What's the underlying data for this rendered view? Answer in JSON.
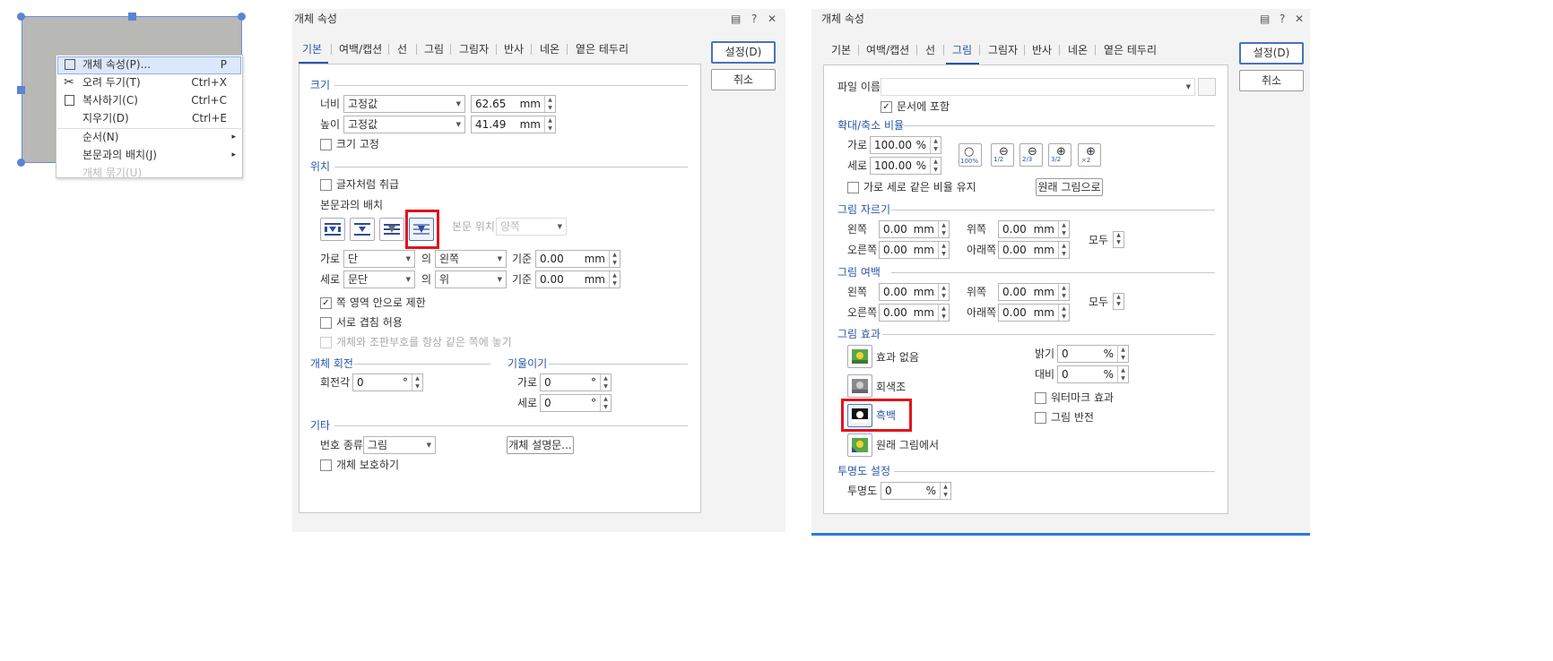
{
  "context": {
    "menu": [
      {
        "label": "개체 속성(P)...",
        "key": "P"
      },
      {
        "label": "오려 두기(T)",
        "key": "Ctrl+X"
      },
      {
        "label": "복사하기(C)",
        "key": "Ctrl+C"
      },
      {
        "label": "지우기(D)",
        "key": "Ctrl+E"
      },
      {
        "label": "순서(N)",
        "key": "▸"
      },
      {
        "label": "본문과의 배치(J)",
        "key": "▸"
      },
      {
        "label": "개체 묶기(U)",
        "key": ""
      }
    ]
  },
  "dlg1": {
    "title": "개체 속성",
    "tabs": [
      "기본",
      "여백/캡션",
      "선",
      "그림",
      "그림자",
      "반사",
      "네온",
      "옅은 테두리"
    ],
    "ok": "설정(D)",
    "cancel": "취소",
    "size": {
      "section": "크기",
      "width_label": "너비",
      "width_mode": "고정값",
      "width_value": "62.65",
      "unit": "mm",
      "height_label": "높이",
      "height_mode": "고정값",
      "height_value": "41.49",
      "lock_label": "크기 고정"
    },
    "position": {
      "section": "위치",
      "treat_as_char": "글자처럼 취급",
      "wrap_label": "본문과의 배치",
      "body_pos_label": "본문 위치",
      "body_pos_value": "양쪽",
      "h_label": "가로",
      "h_rel": "단",
      "of": "의",
      "h_align": "왼쪽",
      "base": "기준",
      "h_value": "0.00",
      "v_label": "세로",
      "v_rel": "문단",
      "v_align": "위",
      "v_value": "0.00",
      "limit_page": "쪽 영역 안으로 제한",
      "allow_overlap": "서로 겹침 허용",
      "same_page": "개체와 조판부호를 항상 같은 쪽에 놓기"
    },
    "rotation": {
      "section": "개체 회전",
      "angle_label": "회전각",
      "angle_value": "0",
      "deg": "°"
    },
    "skew": {
      "section": "기울이기",
      "h_label": "가로",
      "h_value": "0",
      "v_label": "세로",
      "v_value": "0"
    },
    "etc": {
      "section": "기타",
      "num_label": "번호 종류",
      "num_value": "그림",
      "desc_button": "개체 설명문...",
      "protect": "개체 보호하기"
    }
  },
  "dlg2": {
    "title": "개체 속성",
    "tabs": [
      "기본",
      "여백/캡션",
      "선",
      "그림",
      "그림자",
      "반사",
      "네온",
      "옅은 테두리"
    ],
    "ok": "설정(D)",
    "cancel": "취소",
    "file": {
      "label": "파일 이름",
      "embed": "문서에 포함"
    },
    "scale": {
      "section": "확대/축소 비율",
      "h_label": "가로",
      "h_value": "100.00",
      "pct": "%",
      "v_label": "세로",
      "v_value": "100.00",
      "keep_ratio": "가로 세로 같은 비율 유지",
      "orig_button": "원래 그림으로",
      "zoom_labels": [
        "100%",
        "1/2",
        "2/3",
        "3/2",
        "×2"
      ]
    },
    "crop": {
      "section": "그림 자르기",
      "left": "왼쪽",
      "left_v": "0.00",
      "top": "위쪽",
      "top_v": "0.00",
      "right": "오른쪽",
      "right_v": "0.00",
      "bottom": "아래쪽",
      "bottom_v": "0.00",
      "all": "모두",
      "unit": "mm"
    },
    "margin": {
      "section": "그림 여백",
      "left": "왼쪽",
      "left_v": "0.00",
      "top": "위쪽",
      "top_v": "0.00",
      "right": "오른쪽",
      "right_v": "0.00",
      "bottom": "아래쪽",
      "bottom_v": "0.00",
      "all": "모두"
    },
    "effect": {
      "section": "그림 효과",
      "none": "효과 없음",
      "gray": "회색조",
      "bw": "흑백",
      "orig": "원래 그림에서",
      "bright_label": "밝기",
      "bright_v": "0",
      "contrast_label": "대비",
      "contrast_v": "0",
      "watermark": "워터마크 효과",
      "invert": "그림 반전"
    },
    "transparency": {
      "section": "투명도 설정",
      "label": "투명도",
      "value": "0",
      "pct": "%"
    }
  }
}
